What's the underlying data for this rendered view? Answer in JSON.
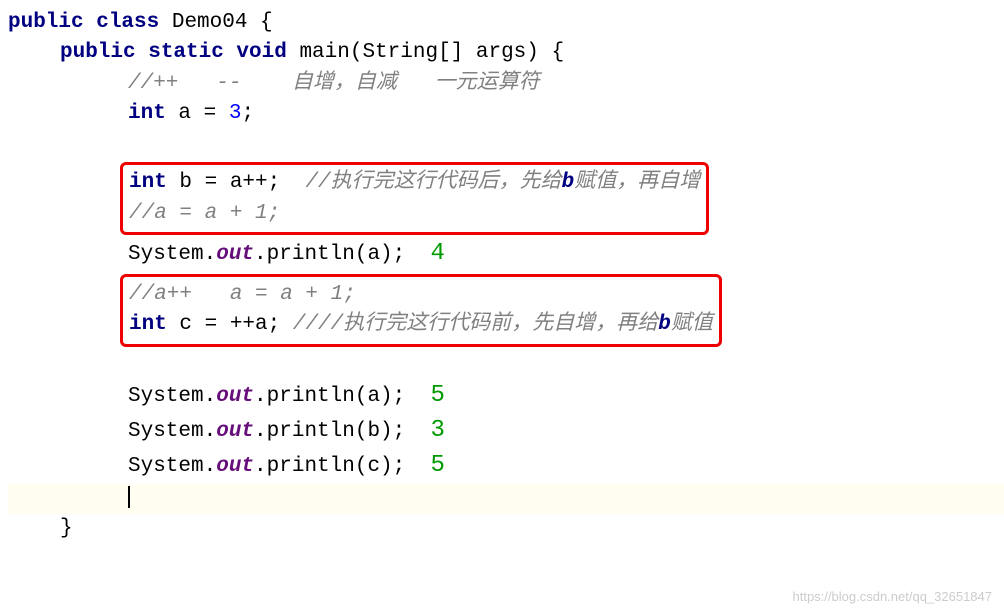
{
  "code": {
    "l1_kw1": "public class",
    "l1_name": " Demo04 {",
    "l2_kw1": "public static void",
    "l2_name": " main(String[] args) {",
    "l3_comment": "//++   --    自增，自减   一元运算符",
    "l4_kw": "int",
    "l4_rest": " a = ",
    "l4_num": "3",
    "l4_semi": ";",
    "box1_l1_kw": "int",
    "box1_l1_rest": " b = a++;  ",
    "box1_l1_comment": "//执行完这行代码后，先给",
    "box1_l1_comment_b": "b",
    "box1_l1_comment_end": "赋值，再自增",
    "box1_l2_comment": "//a = a + 1;",
    "l6_pre": "System.",
    "l6_out": "out",
    "l6_post": ".println(a);  ",
    "l6_result": "4",
    "box2_l1_comment": "//a++   a = a + 1;",
    "box2_l2_kw": "int",
    "box2_l2_rest": " c = ++a; ",
    "box2_l2_comment": "////执行完这行代码前，先自增，再给",
    "box2_l2_comment_b": "b",
    "box2_l2_comment_end": "赋值",
    "l9_pre": "System.",
    "l9_out": "out",
    "l9_post": ".println(a);  ",
    "l9_result": "5",
    "l10_pre": "System.",
    "l10_out": "out",
    "l10_post": ".println(b);  ",
    "l10_result": "3",
    "l11_pre": "System.",
    "l11_out": "out",
    "l11_post": ".println(c);  ",
    "l11_result": "5",
    "l13_close": "}"
  },
  "watermark": "https://blog.csdn.net/qq_32651847"
}
